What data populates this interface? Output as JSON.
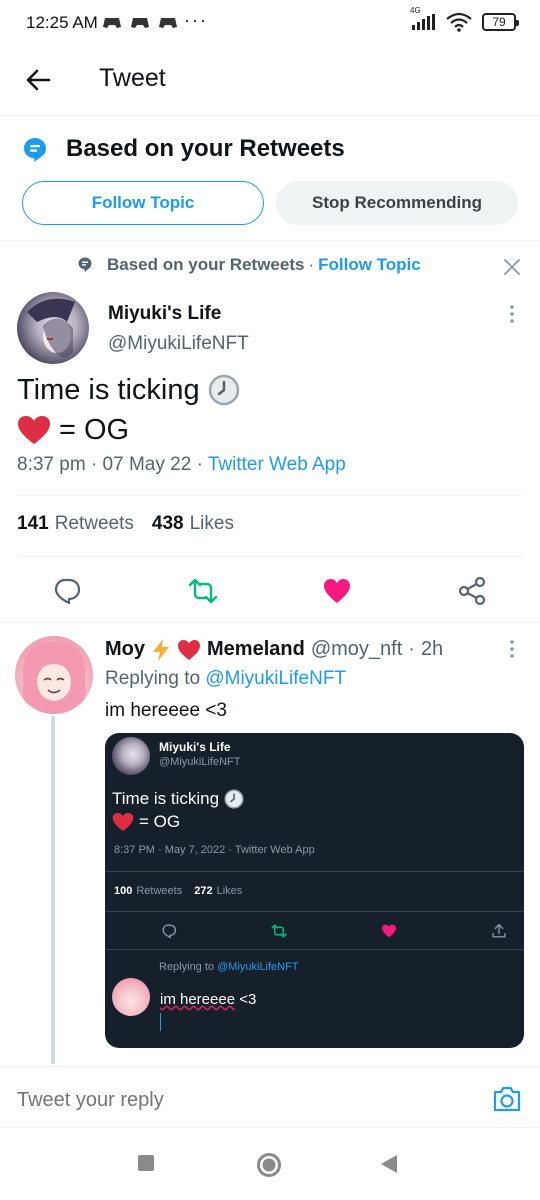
{
  "status_bar": {
    "time": "12:25 AM",
    "more": "···",
    "network": "4G",
    "battery": "79"
  },
  "header": {
    "title": "Tweet"
  },
  "topic_banner": {
    "title": "Based on your Retweets",
    "follow_label": "Follow Topic",
    "stop_label": "Stop Recommending"
  },
  "social_context": {
    "text": "Based on your Retweets",
    "separator": "·",
    "follow_label": "Follow Topic"
  },
  "tweet": {
    "author_name": "Miyuki's Life",
    "author_handle": "@MiyukiLifeNFT",
    "line1": "Time is ticking",
    "line2": "= OG",
    "time": "8:37 pm",
    "date": "07 May 22",
    "source": "Twitter Web App",
    "retweets_count": "141",
    "retweets_label": "Retweets",
    "likes_count": "438",
    "likes_label": "Likes"
  },
  "reply": {
    "name_first": "Moy",
    "name_last": "Memeland",
    "handle": "@moy_nft",
    "time": "2h",
    "replying_prefix": "Replying to",
    "replying_handle": "@MiyukiLifeNFT",
    "text": "im hereeee <3"
  },
  "embedded_screenshot": {
    "author_name": "Miyuki's Life",
    "author_handle": "@MiyukiLifeNFT",
    "line1": "Time is ticking",
    "line2": "= OG",
    "meta": "8:37 PM · May 7, 2022 · Twitter Web App",
    "retweets_count": "100",
    "retweets_label": "Retweets",
    "likes_count": "272",
    "likes_label": "Likes",
    "replying_prefix": "Replying to",
    "replying_handle": "@MiyukiLifeNFT",
    "reply_word": "im hereeee",
    "reply_rest": " <3"
  },
  "reply_bar": {
    "placeholder": "Tweet your reply"
  },
  "colors": {
    "accent": "#1d9bf0",
    "retweet_green": "#00ba7c",
    "like_pink": "#f91880",
    "dark_bg": "#15202b"
  },
  "icons": [
    "back-arrow-icon",
    "topic-icon",
    "close-icon",
    "more-icon",
    "reply-icon",
    "retweet-icon",
    "heart-icon",
    "share-icon",
    "lightning-icon",
    "red-heart-emoji-icon",
    "clock-emoji-icon",
    "camera-icon",
    "recent-apps-icon",
    "home-icon",
    "back-nav-icon"
  ]
}
